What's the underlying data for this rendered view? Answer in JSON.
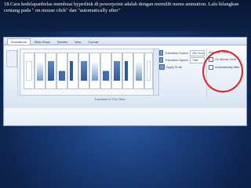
{
  "caption": "18.Cara kedelapanbelas membuat hyperlink di powerpoint adalah dengan memilih menu animation. Lalu hilangkan centang pada \" on mouse click\" dan \"automatically after\"",
  "ribbon": {
    "tabs": [
      "Animations",
      "Slide Show",
      "Review",
      "View",
      "Format"
    ],
    "active_tab": "Animations",
    "gallery_label": "Transition to This Slide",
    "transition_sound_label": "Transition Sound:",
    "transition_sound_value": "[No Sound]",
    "transition_speed_label": "Transition Speed:",
    "transition_speed_value": "Fast",
    "apply_all_label": "Apply To All",
    "advance_label": "Advance Slide",
    "on_mouse_click_label": "On Mouse Click",
    "automatically_label": "Automatically After"
  },
  "colors": {
    "background": "#0d2146",
    "highlight_circle": "#e02222"
  }
}
